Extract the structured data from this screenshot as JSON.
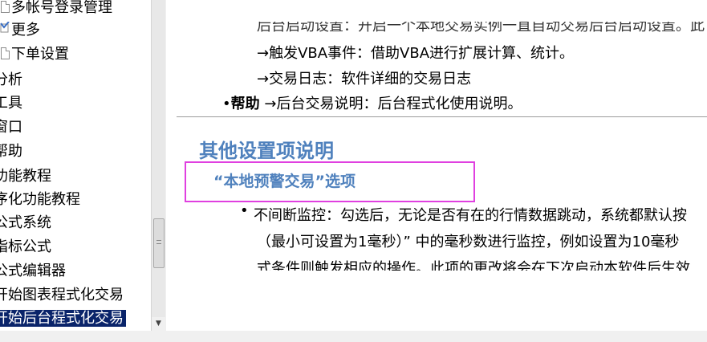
{
  "tree": {
    "items": [
      {
        "label": "多帐号登录管理",
        "icon": "doc-icon"
      },
      {
        "label": "更多",
        "icon": "checkmark-doc-icon"
      },
      {
        "label": "下单设置",
        "icon": "doc-icon"
      },
      {
        "label": "分析"
      },
      {
        "label": "工具"
      },
      {
        "label": "窗口"
      },
      {
        "label": "帮助"
      },
      {
        "label": "功能教程"
      },
      {
        "label": "序化功能教程"
      },
      {
        "label": "公式系统"
      },
      {
        "label": "指标公式"
      },
      {
        "label": "公式编辑器"
      },
      {
        "label": "开始图表程式化交易"
      },
      {
        "label": "开始后台程式化交易",
        "selected": true
      }
    ]
  },
  "content": {
    "cut_top": "后台启动设置：开启一个本地交易实例一直自动交易后台启动设置。此",
    "vba_line": "→触发VBA事件：借助VBA进行扩展计算、统计。",
    "log_line": "→交易日志：软件详细的交易日志",
    "help_bullet": "•",
    "help_label": "帮助",
    "help_text": "→后台交易说明：后台程式化使用说明。",
    "section_title": "其他设置项说明",
    "sub_title": "“本地预警交易”选项",
    "para_bullet": "•",
    "para_line1": "不间断监控：勾选后，无论是否有在的行情数据跳动，系统都默认按",
    "para_line2": "（最小可设置为1毫秒）” 中的毫秒数进行监控，例如设置为10毫秒",
    "para_line3": "式条件则触发相应的操作。此项的更改将会在下次启动本软件后生效"
  },
  "colors": {
    "heading": "#4f81bd",
    "highlight_border": "#e040e0",
    "selected_bg": "#0a246a"
  }
}
